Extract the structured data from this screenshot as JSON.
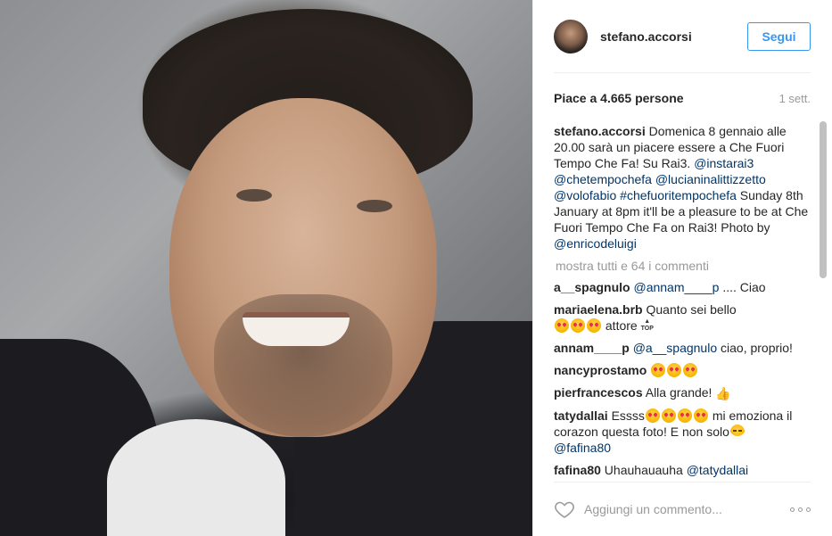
{
  "post": {
    "username": "stefano.accorsi",
    "follow_label": "Segui",
    "likes_text": "Piace a 4.665 persone",
    "time_ago": "1 sett.",
    "caption": {
      "username": "stefano.accorsi",
      "text_1": " Domenica 8 gennaio alle 20.00 sarà un piacere essere a Che Fuori Tempo Che Fa! Su Rai3. ",
      "mention_1": "@instarai3",
      "mention_2": "@chetempochefa",
      "mention_3": "@lucianinalittizzetto",
      "mention_4": "@volofabio",
      "hashtag_1": "#chefuoritempochefa",
      "text_2": " Sunday 8th January at 8pm it'll be a pleasure to be at Che Fuori Tempo Che Fa on Rai3! Photo by ",
      "mention_5": "@enricodeluigi"
    },
    "show_all_comments": "mostra tutti e 64 i commenti"
  },
  "comments": [
    {
      "username": "a__spagnulo",
      "mention": "@annam____p",
      "text": " .... Ciao"
    },
    {
      "username": "mariaelena.brb",
      "text": " Quanto sei bello",
      "text_2": " attore "
    },
    {
      "username": "annam____p",
      "mention": "@a__spagnulo",
      "text": " ciao, proprio!"
    },
    {
      "username": "nancyprostamo"
    },
    {
      "username": "pierfrancescos",
      "text": " Alla grande! "
    },
    {
      "username": "tatydallai",
      "text": " Essss",
      "text_2": " mi emoziona il corazon questa foto! E non solo",
      "mention": "@fafina80"
    },
    {
      "username": "fafina80",
      "text": " Uhauhauauha ",
      "mention": "@tatydallai"
    }
  ],
  "footer": {
    "comment_placeholder": "Aggiungi un commento..."
  },
  "icons": {
    "heart": "heart-outline-icon",
    "more": "more-options-icon",
    "emoji_heart_eyes": "heart-eyes-emoji",
    "emoji_tears_of_joy": "tears-of-joy-emoji",
    "emoji_thumbs_up": "thumbs-up-emoji",
    "emoji_top": "top-arrow-emoji"
  },
  "colors": {
    "link": "#003569",
    "accent": "#3897f0",
    "muted": "#999999"
  }
}
